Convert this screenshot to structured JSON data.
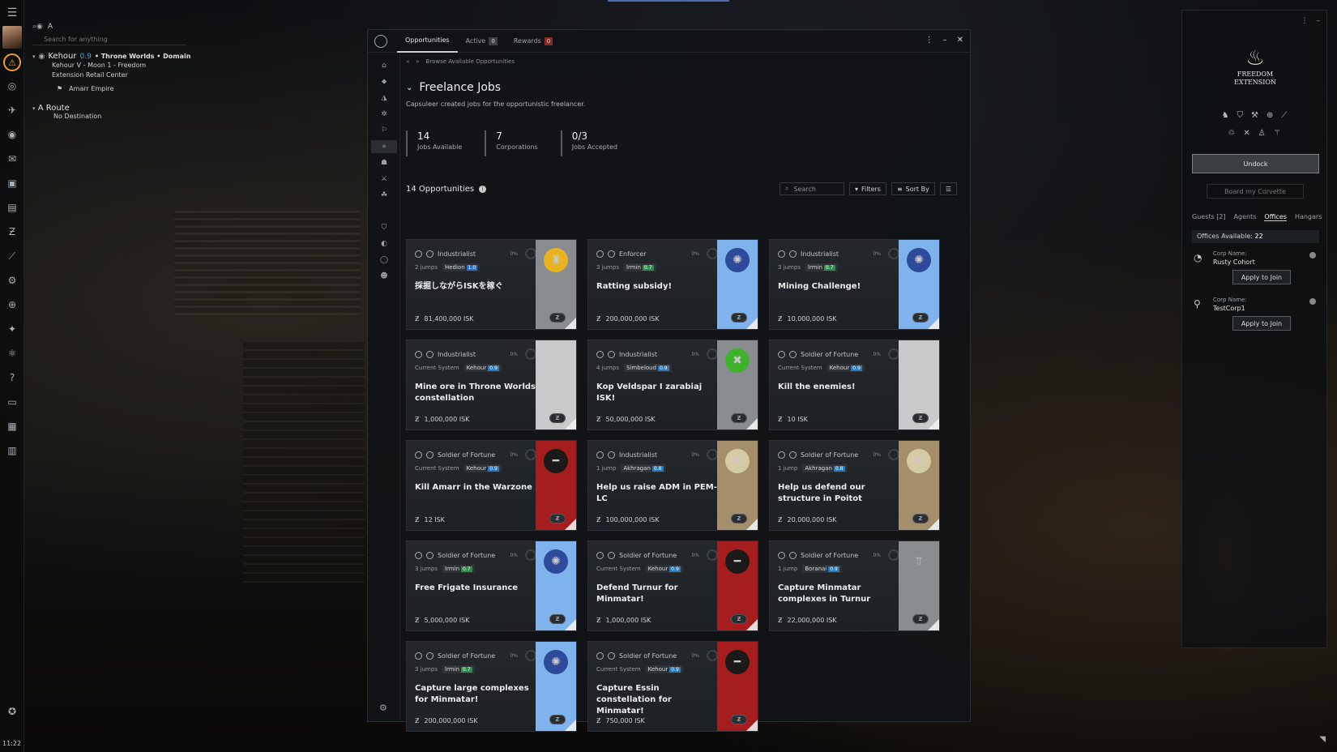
{
  "location": {
    "search_label": "A",
    "search_placeholder": "Search for anything",
    "system": "Kehour",
    "security": "0.9",
    "region_path": "• Throne Worlds • Domain",
    "station_line1": "Kehour V - Moon 1 - Freedom",
    "station_line2": "Extension Retail Center",
    "faction": "Amarr Empire",
    "route_title": "A Route",
    "route_destination": "No Destination"
  },
  "clock": "11:22",
  "window": {
    "tabs": [
      {
        "label": "Opportunities",
        "count": ""
      },
      {
        "label": "Active",
        "count": "0"
      },
      {
        "label": "Rewards",
        "count": "0"
      }
    ],
    "breadcrumb": "Browse Available Opportunities",
    "title": "Freelance Jobs",
    "description": "Capsuleer created jobs for the opportunistic freelancer.",
    "stats": [
      {
        "num": "14",
        "label": "Jobs Available"
      },
      {
        "num": "7",
        "label": "Corporations"
      },
      {
        "num": "0/3",
        "label": "Jobs Accepted"
      }
    ],
    "list_title": "14 Opportunities",
    "search_placeholder": "Search",
    "filters_label": "Filters",
    "sort_label": "Sort By"
  },
  "jobs": [
    {
      "category": "Industrialist",
      "pct": "0%",
      "loc_prefix": "2 jumps",
      "system": "Hedion",
      "sec": "1.0",
      "title": "採掘しながらISKを稼ぐ",
      "reward": "81,400,000 ISK",
      "side_color": "#8a8d90",
      "logo_icon": "gold-emblem-icon",
      "logo_bg": "#e8b320",
      "logo_glyph": "♜"
    },
    {
      "category": "Enforcer",
      "pct": "0%",
      "loc_prefix": "3 jumps",
      "system": "Irmin",
      "sec": "0.7",
      "title": "Ratting subsidy!",
      "reward": "200,000,000 ISK",
      "side_color": "#7fb3ee",
      "logo_icon": "blue-emblem-icon",
      "logo_bg": "#2e4a9a",
      "logo_glyph": "✺"
    },
    {
      "category": "Industrialist",
      "pct": "0%",
      "loc_prefix": "3 jumps",
      "system": "Irmin",
      "sec": "0.7",
      "title": "Mining Challenge!",
      "reward": "10,000,000 ISK",
      "side_color": "#7fb3ee",
      "logo_icon": "blue-emblem-icon",
      "logo_bg": "#2e4a9a",
      "logo_glyph": "✺"
    },
    {
      "category": "Industrialist",
      "pct": "0%",
      "loc_prefix": "Current System",
      "system": "Kehour",
      "sec": "0.9",
      "title": "Mine ore in Throne Worlds constellation",
      "reward": "1,000,000 ISK",
      "side_color": "#c7c9cb",
      "logo_icon": "white-spire-icon",
      "logo_bg": "transparent",
      "logo_glyph": "⚲"
    },
    {
      "category": "Industrialist",
      "pct": "0%",
      "loc_prefix": "4 jumps",
      "system": "Simbeloud",
      "sec": "0.9",
      "title": "Kop Veldspar I zarabiaj ISK!",
      "reward": "50,000,000 ISK",
      "side_color": "#8a8d90",
      "logo_icon": "green-skull-icon",
      "logo_bg": "#3fb22c",
      "logo_glyph": "✖"
    },
    {
      "category": "Soldier of Fortune",
      "pct": "0%",
      "loc_prefix": "Current System",
      "system": "Kehour",
      "sec": "0.9",
      "title": "Kill the enemies!",
      "reward": "10 ISK",
      "side_color": "#c7c9cb",
      "logo_icon": "white-spire-icon",
      "logo_bg": "transparent",
      "logo_glyph": "⚲"
    },
    {
      "category": "Soldier of Fortune",
      "pct": "0%",
      "loc_prefix": "Current System",
      "system": "Kehour",
      "sec": "0.9",
      "title": "Kill Amarr in the Warzone",
      "reward": "12 ISK",
      "side_color": "#a51d1d",
      "logo_icon": "red-stripe-icon",
      "logo_bg": "#1a1a1a",
      "logo_glyph": "━"
    },
    {
      "category": "Industrialist",
      "pct": "0%",
      "loc_prefix": "1 jump",
      "system": "Akhragan",
      "sec": "0.8",
      "title": "Help us raise ADM in PEM-LC",
      "reward": "100,000,000 ISK",
      "side_color": "#a58e6c",
      "logo_icon": "cross-shield-icon",
      "logo_bg": "#d6c9a5",
      "logo_glyph": "✕"
    },
    {
      "category": "Soldier of Fortune",
      "pct": "0%",
      "loc_prefix": "1 jump",
      "system": "Akhragan",
      "sec": "0.8",
      "title": "Help us defend our structure in Poitot",
      "reward": "20,000,000 ISK",
      "side_color": "#a58e6c",
      "logo_icon": "cross-shield-icon",
      "logo_bg": "#d6c9a5",
      "logo_glyph": "✕"
    },
    {
      "category": "Soldier of Fortune",
      "pct": "0%",
      "loc_prefix": "3 jumps",
      "system": "Irmin",
      "sec": "0.7",
      "title": "Free Frigate Insurance",
      "reward": "5,000,000 ISK",
      "side_color": "#7fb3ee",
      "logo_icon": "blue-emblem-icon",
      "logo_bg": "#2e4a9a",
      "logo_glyph": "✺"
    },
    {
      "category": "Soldier of Fortune",
      "pct": "0%",
      "loc_prefix": "Current System",
      "system": "Kehour",
      "sec": "0.9",
      "title": "Defend Turnur for Minmatar!",
      "reward": "1,000,000 ISK",
      "side_color": "#a51d1d",
      "logo_icon": "red-stripe-icon",
      "logo_bg": "#1a1a1a",
      "logo_glyph": "━"
    },
    {
      "category": "Soldier of Fortune",
      "pct": "0%",
      "loc_prefix": "1 jump",
      "system": "Boranai",
      "sec": "0.9",
      "title": "Capture Minmatar complexes in Turnur",
      "reward": "22,000,000 ISK",
      "side_color": "#8a8d90",
      "logo_icon": "grey-symbol-icon",
      "logo_bg": "transparent",
      "logo_glyph": "⫪"
    },
    {
      "category": "Soldier of Fortune",
      "pct": "0%",
      "loc_prefix": "3 jumps",
      "system": "Irmin",
      "sec": "0.7",
      "title": "Capture large complexes for Minmatar!",
      "reward": "200,000,000 ISK",
      "side_color": "#7fb3ee",
      "logo_icon": "blue-emblem-icon",
      "logo_bg": "#2e4a9a",
      "logo_glyph": "✺"
    },
    {
      "category": "Soldier of Fortune",
      "pct": "0%",
      "loc_prefix": "Current System",
      "system": "Kehour",
      "sec": "0.9",
      "title": "Capture Essin constellation for Minmatar!",
      "reward": "750,000 ISK",
      "side_color": "#a51d1d",
      "logo_icon": "red-stripe-icon",
      "logo_bg": "#1a1a1a",
      "logo_glyph": "━"
    }
  ],
  "station": {
    "corp_line1": "FREEDOM",
    "corp_line2": "EXTENSION",
    "undock_label": "Undock",
    "board_label": "Board my Corvette",
    "tabs": [
      "Guests [2]",
      "Agents",
      "Offices",
      "Hangars"
    ],
    "offices_label": "Offices Available:",
    "offices_count": "22",
    "offices": [
      {
        "label": "Corp Name:",
        "name": "Rusty Cohort",
        "button": "Apply to Join"
      },
      {
        "label": "Corp Name:",
        "name": "TestCorp1",
        "button": "Apply to Join"
      }
    ]
  }
}
